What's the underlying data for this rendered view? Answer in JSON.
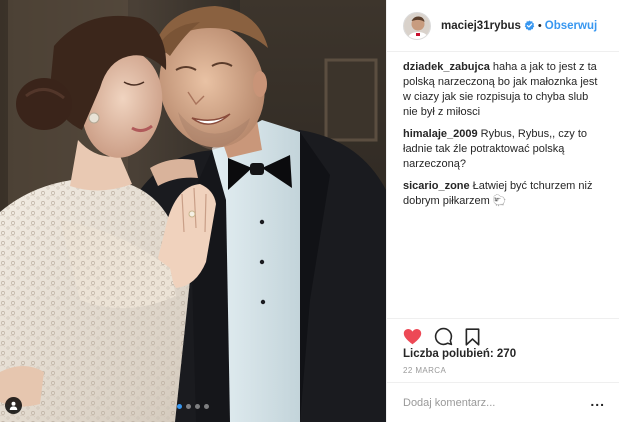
{
  "post": {
    "media_count": 4,
    "active_media_index": 0,
    "tag_icon": "user-tag-icon"
  },
  "header": {
    "username": "maciej31rybus",
    "separator": "•",
    "follow_label": "Obserwuj",
    "verified_icon": "verified-badge-icon"
  },
  "comments": [
    {
      "username": "dziadek_zabujca",
      "text": "haha a jak to jest z ta polską narzeczoną bo jak małoznka jest w ciazy jak sie rozpisuja to chyba slub nie był z miłosci"
    },
    {
      "username": "himalaje_2009",
      "text": "Rybus, Rybus,, czy to ładnie tak źle potraktować polską narzeczoną?"
    },
    {
      "username": "sicario_zone",
      "text": "Łatwiej być tchurzem niż dobrym piłkarzem 🐑"
    }
  ],
  "actions": {
    "like_icon": "heart-icon",
    "comment_icon": "comment-bubble-icon",
    "save_icon": "bookmark-icon",
    "liked": true,
    "like_color": "#ed4956"
  },
  "likes": {
    "label": "Liczba polubień: 270"
  },
  "date": "22 MARCA",
  "add_comment": {
    "placeholder": "Dodaj komentarz...",
    "more_label": "..."
  },
  "colors": {
    "accent": "#3897f0",
    "border": "#efefef",
    "muted": "#999999"
  }
}
